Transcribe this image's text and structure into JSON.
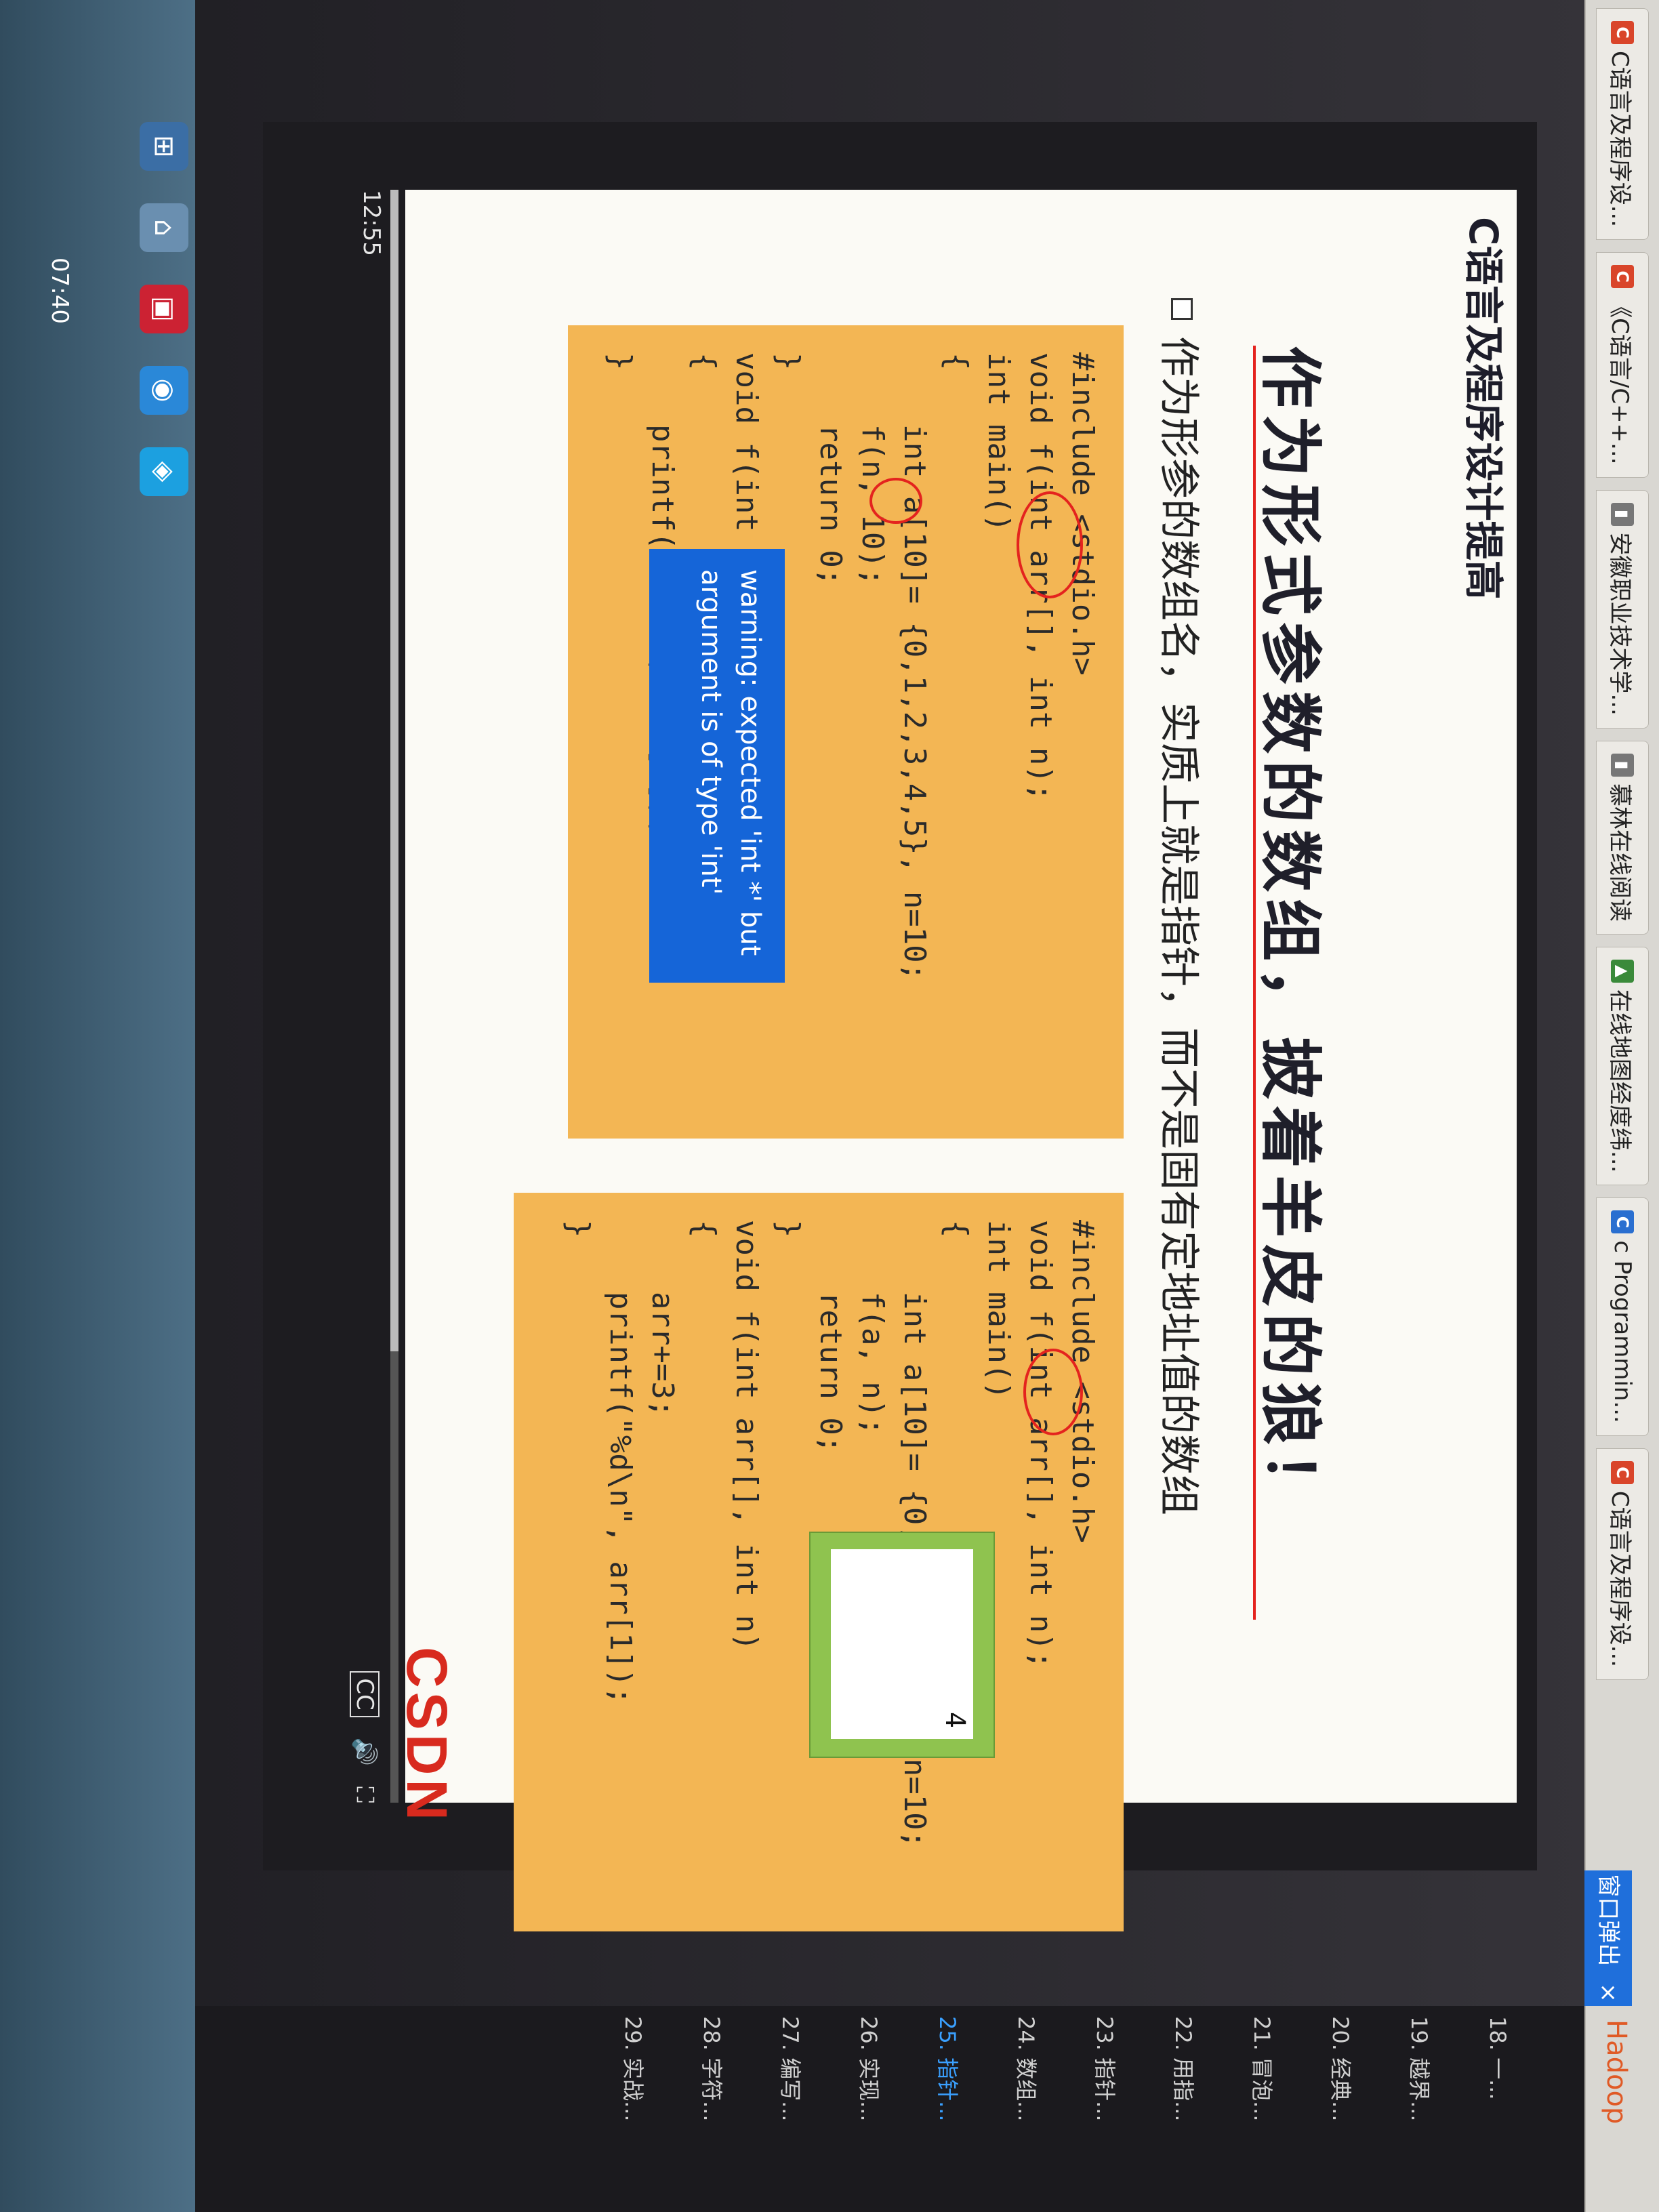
{
  "browser": {
    "tabs": [
      {
        "icon": "C",
        "label": "C语言及程序设..."
      },
      {
        "icon": "C",
        "label": "《C语言/C++..."
      },
      {
        "icon": "▮",
        "label": "安徽职业技术学..."
      },
      {
        "icon": "▮",
        "label": "慕林在线阅读"
      },
      {
        "icon": "▲",
        "label": "在线地图经度纬..."
      },
      {
        "icon": "C",
        "label": "c Programmin..."
      },
      {
        "icon": "C",
        "label": "C语言及程序设..."
      }
    ]
  },
  "slide": {
    "course_title": "C语言及程序设计提高",
    "heading": "作为形式参数的数组，披着羊皮的狼！",
    "bullet": "作为形参的数组名，实质上就是指针，而不是固有定地址值的数组",
    "code_left": [
      "#include <stdio.h>",
      "void f(int arr[], int n);",
      "int main()",
      "{",
      "    int a[10]= {0,1,2,3,4,5}, n=10;",
      "    f(n, 10);",
      "    return 0;",
      "}",
      "void f(int arr[], int n)",
      "{",
      "    printf(\"%d\\n\", arr[1]);",
      "}"
    ],
    "code_right": [
      "#include <stdio.h>",
      "void f(int arr[], int n);",
      "int main()",
      "{",
      "    int a[10]= {0,1,2,3,4,5}, n=10;",
      "    f(a, n);",
      "    return 0;",
      "}",
      "void f(int arr[], int n)",
      "{",
      "    arr+=3;",
      "    printf(\"%d\\n\", arr[1]);",
      "}"
    ],
    "warning": "warning: expected 'int *' but argument is of type 'int'",
    "output_value": "4",
    "brand": "CSDN"
  },
  "player": {
    "time": "12:55",
    "cc_label": "CC",
    "progress": 0.72,
    "popout_label": "窗口弹出",
    "close_label": "×"
  },
  "sidebar": {
    "header": "Hadoop",
    "chapters": [
      "18. 一...",
      "19. 越界...",
      "20. 经典...",
      "21. 冒泡...",
      "22. 用指...",
      "23. 指针...",
      "24. 数组...",
      "25. 指针...",
      "26. 实现...",
      "27. 编写...",
      "28. 字符...",
      "29. 实战..."
    ],
    "active_index": 7
  },
  "taskbar": {
    "clock": "07:40"
  },
  "colors": {
    "code_panel": "#f3b654",
    "warning_bg": "#1565d8",
    "annotation_red": "#e4231e",
    "brand_red": "#d82a1e"
  }
}
